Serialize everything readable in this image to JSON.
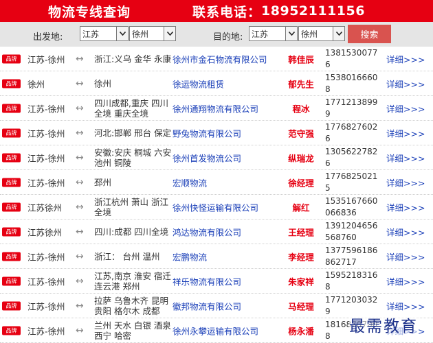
{
  "header": {
    "title": "物流专线查询",
    "phone_label": "联系电话：",
    "phone_number": "18952111156"
  },
  "search": {
    "from_label": "出发地:",
    "from_province": "江苏",
    "from_city": "徐州",
    "to_label": "目的地:",
    "to_province": "江苏",
    "to_city": "徐州",
    "button_label": "搜索"
  },
  "rows": [
    {
      "badge": "品牌",
      "origin": "江苏-徐州",
      "arrow": "↔",
      "dest": "浙江:义乌 金华 永康",
      "company": "徐州市金石物流有限公司",
      "contact": "韩佳辰",
      "tel": "13815300776",
      "detail": "详细>>>"
    },
    {
      "badge": "品牌",
      "origin": "徐州",
      "arrow": "↔",
      "dest": "徐州",
      "company": "徐运物流租赁",
      "contact": "郁先生",
      "tel": "15380166608",
      "detail": "详细>>>"
    },
    {
      "badge": "品牌",
      "origin": "江苏-徐州",
      "arrow": "↔",
      "dest": "四川成都,重庆 四川全境 重庆全境",
      "company": "徐州通翔物流有限公司",
      "contact": "程冰",
      "tel": "17712138999",
      "detail": "详细>>>"
    },
    {
      "badge": "品牌",
      "origin": "江苏-徐州",
      "arrow": "↔",
      "dest": "河北:邯郸 邢台 保定",
      "company": "野兔物流有限公司",
      "contact": "范守强",
      "tel": "17768276026",
      "detail": "详细>>>"
    },
    {
      "badge": "品牌",
      "origin": "江苏-徐州",
      "arrow": "↔",
      "dest": "安徽:安庆 桐城 六安 池州 铜陵",
      "company": "徐州首发物流公司",
      "contact": "纵瑞龙",
      "tel": "13056227826",
      "detail": "详细>>>"
    },
    {
      "badge": "品牌",
      "origin": "江苏-徐州",
      "arrow": "↔",
      "dest": "邳州",
      "company": "宏顺物流",
      "contact": "徐经理",
      "tel": "17768250215",
      "detail": "详细>>>"
    },
    {
      "badge": "品牌",
      "origin": "江苏徐州",
      "arrow": "↔",
      "dest": "浙江杭州 萧山 浙江全境",
      "company": "徐州快怪运输有限公司",
      "contact": "解红",
      "tel": "1535167660066836",
      "detail": "详细>>>"
    },
    {
      "badge": "品牌",
      "origin": "江苏徐州",
      "arrow": "↔",
      "dest": "四川:成都 四川全境",
      "company": "鸿达物流有限公司",
      "contact": "王经理",
      "tel": "1391204656568760",
      "detail": "详细>>>"
    },
    {
      "badge": "品牌",
      "origin": "江苏-徐州",
      "arrow": "↔",
      "dest": "浙江： 台州 温州",
      "company": "宏鹏物流",
      "contact": "李经理",
      "tel": "1377596186862717",
      "detail": "详细>>>"
    },
    {
      "badge": "品牌",
      "origin": "江苏-徐州",
      "arrow": "↔",
      "dest": "江苏,南京 淮安 宿迁 连云港 郑州",
      "company": "祥乐物流有限公司",
      "contact": "朱家祥",
      "tel": "15952183168",
      "detail": "详细>>>"
    },
    {
      "badge": "品牌",
      "origin": "江苏-徐州",
      "arrow": "↔",
      "dest": "拉萨 乌鲁木齐 昆明 贵阳 格尔木 成都",
      "company": "徽邦物流有限公司",
      "contact": "马经理",
      "tel": "17712030329",
      "detail": "详细>>>"
    },
    {
      "badge": "品牌",
      "origin": "江苏-徐州",
      "arrow": "↔",
      "dest": "兰州 天水 白银 酒泉 西宁 哈密",
      "company": "徐州永攀运输有限公司",
      "contact": "杨永潘",
      "tel": "18168707008",
      "detail": "详细>>>"
    }
  ],
  "watermark": "最需教育",
  "colors": {
    "header_bg": "#e60012",
    "search_bg": "#e5e5e5",
    "button_bg": "#d9534f",
    "link": "#1a3fb8",
    "contact": "#e60012"
  },
  "icons": {
    "swap": "double-arrow-icon",
    "dropdown": "chevron-down-icon"
  }
}
